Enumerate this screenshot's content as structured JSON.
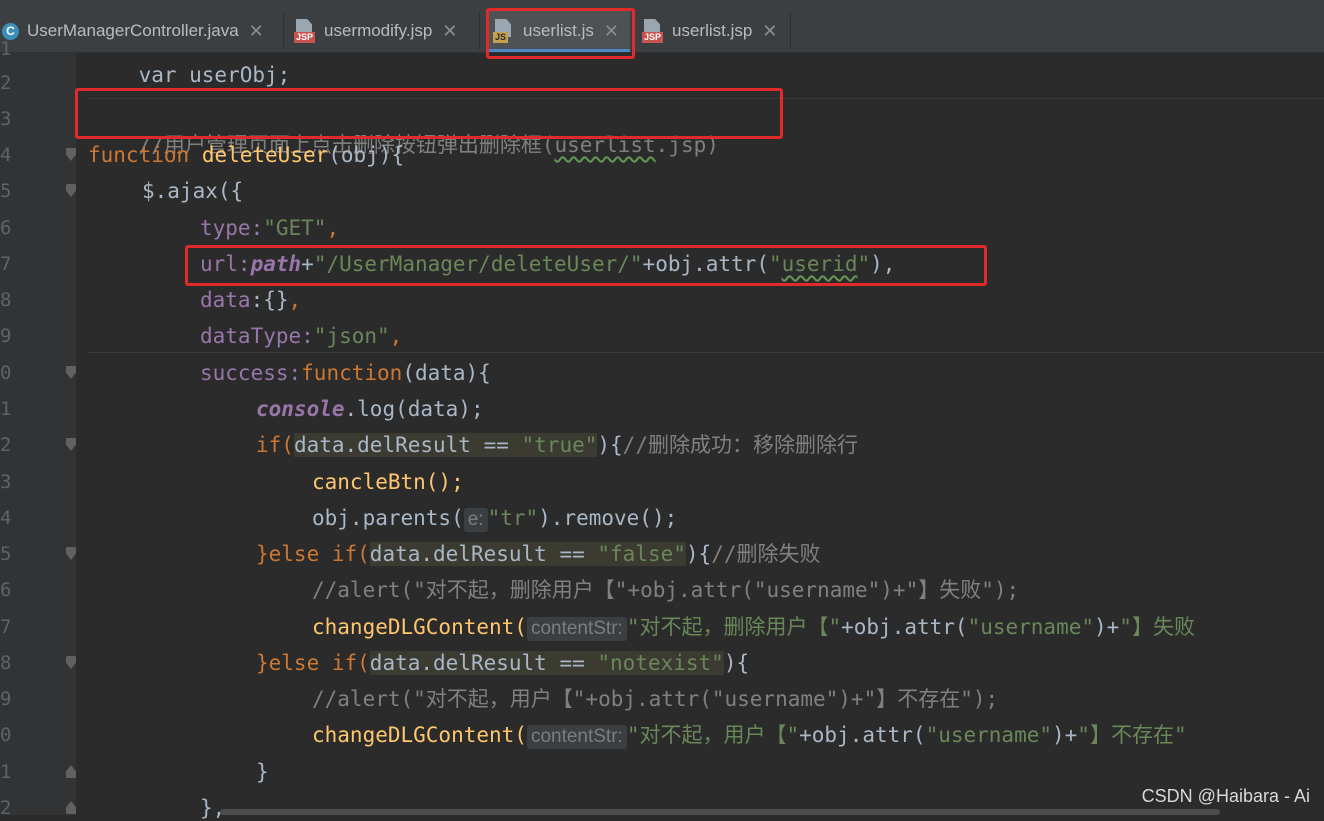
{
  "tabs": [
    {
      "label": "UserManagerController.java",
      "icon": "java-class-icon",
      "icon_text": "C"
    },
    {
      "label": "usermodify.jsp",
      "icon": "jsp-file-icon",
      "icon_text": "JSP"
    },
    {
      "label": "userlist.js",
      "icon": "js-file-icon",
      "icon_text": "JS",
      "active": true
    },
    {
      "label": "userlist.jsp",
      "icon": "jsp-file-icon",
      "icon_text": "JSP"
    }
  ],
  "gutter": {
    "line_numbers": [
      "1",
      "2",
      "3",
      "4",
      "5",
      "6",
      "7",
      "8",
      "9",
      "0",
      "1",
      "2",
      "3",
      "4",
      "5",
      "6",
      "7",
      "8",
      "9",
      "0",
      "1",
      "2"
    ]
  },
  "code": {
    "l1": "var userObj;",
    "l3": "//用户管理页面上点击删除按钮弹出删除框(userlist.jsp)",
    "l4_kw": "function",
    "l4_fn": "deleteUser",
    "l4_rest": "(obj){",
    "l5": "$.ajax({",
    "l6_key": "type:",
    "l6_val": "\"GET\"",
    "l7_key": "url:",
    "l7_path": "path",
    "l7_plus": "+",
    "l7_str": "\"/UserManager/deleteUser/\"",
    "l7_mid": "+obj.attr(",
    "l7_arg": "\"userid\"",
    "l7_end": "),",
    "l8": "data:{},",
    "l9_key": "dataType:",
    "l9_val": "\"json\"",
    "l10_key": "success:",
    "l10_kw": "function",
    "l10_rest": "(data){",
    "l11_obj": "console",
    "l11_rest": ".log(data);",
    "l12_kw": "if(",
    "l12_cond": "data.delResult == ",
    "l12_val": "\"true\"",
    "l12_end": "){",
    "l12_cmt": "//删除成功：移除删除行",
    "l13": "cancleBtn();",
    "l14_a": "obj.parents(",
    "l14_hint": "e:",
    "l14_str": "\"tr\"",
    "l14_b": ").remove();",
    "l15_kw": "}else if(",
    "l15_cond": "data.delResult == ",
    "l15_val": "\"false\"",
    "l15_end": "){",
    "l15_cmt": "//删除失败",
    "l16": "//alert(\"对不起，删除用户【\"+obj.attr(\"username\")+\"】失败\");",
    "l17_fn": "changeDLGContent(",
    "l17_hint": "contentStr:",
    "l17_s1": "\"对不起，删除用户【\"",
    "l17_mid": "+obj.attr(",
    "l17_s2": "\"username\"",
    "l17_end": ")+",
    "l17_s3": "\"】失败",
    "l18_kw": "}else if(",
    "l18_cond": "data.delResult == ",
    "l18_val": "\"notexist\"",
    "l18_end": "){",
    "l19": "//alert(\"对不起，用户【\"+obj.attr(\"username\")+\"】不存在\");",
    "l20_fn": "changeDLGContent(",
    "l20_hint": "contentStr:",
    "l20_s1": "\"对不起，用户【\"",
    "l20_mid": "+obj.attr(",
    "l20_s2": "\"username\"",
    "l20_end": ")+",
    "l20_s3": "\"】不存在\"",
    "l21": "}",
    "l22": "},"
  },
  "watermark": "CSDN @Haibara - Ai",
  "colors": {
    "background": "#2b2b2b",
    "keyword": "#cc7832",
    "function": "#ffc66d",
    "string": "#6a8759",
    "comment": "#808080",
    "highlight_box": "#e12b2b"
  }
}
